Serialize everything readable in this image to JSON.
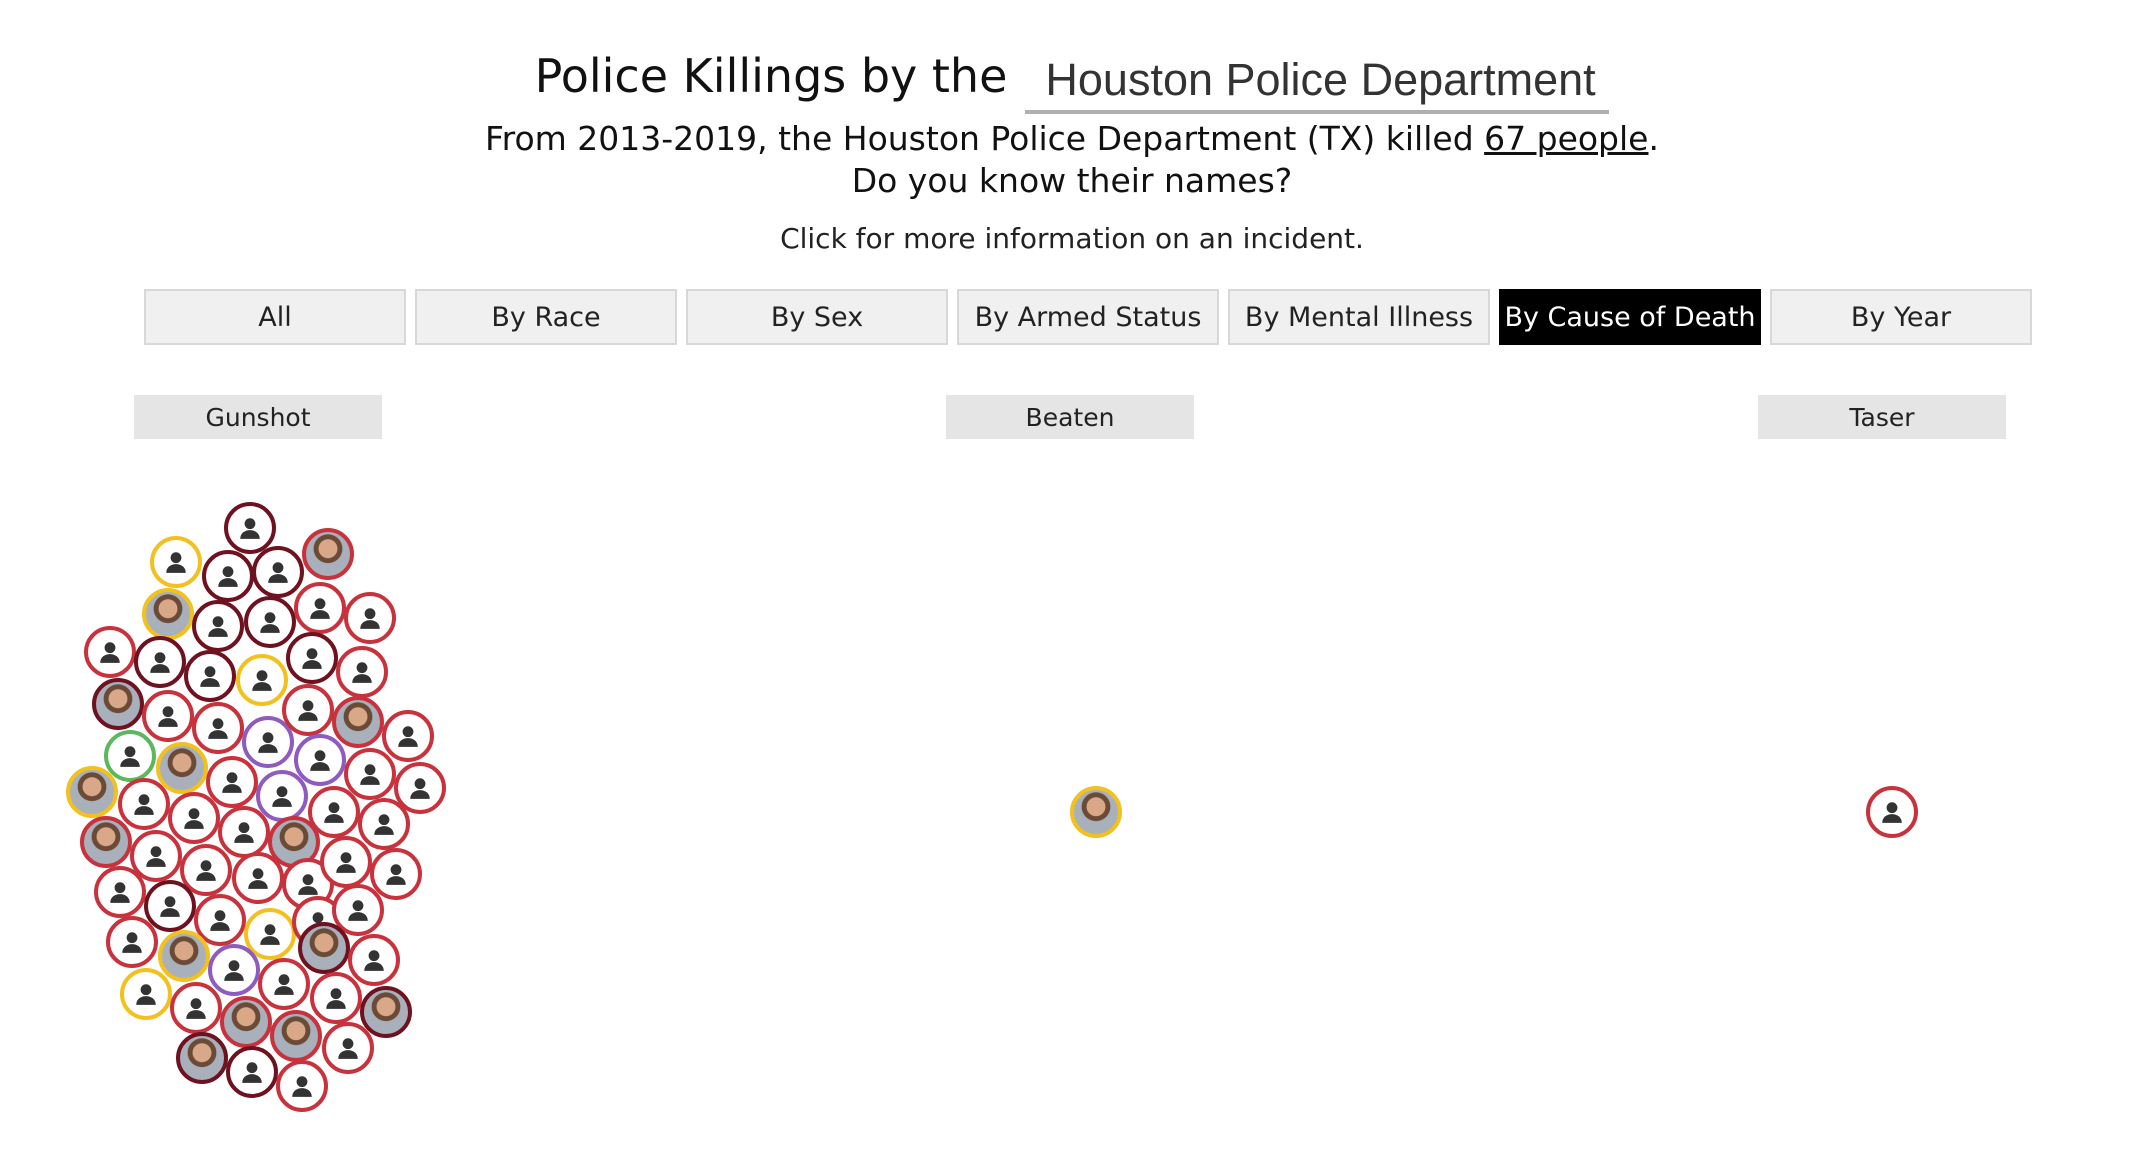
{
  "header": {
    "title_prefix": "Police Killings by the",
    "department": "Houston Police Department (TX"
  },
  "summary": {
    "line1_prefix": "From 2013-2019, the Houston Police Department (TX) killed ",
    "line1_link": "67 people",
    "line1_suffix": ".",
    "line2": "Do you know their names?"
  },
  "hint": "Click for more information on an incident.",
  "tabs": [
    {
      "label": "All",
      "active": false
    },
    {
      "label": "By Race",
      "active": false
    },
    {
      "label": "By Sex",
      "active": false
    },
    {
      "label": "By Armed Status",
      "active": false
    },
    {
      "label": "By Mental Illness",
      "active": false
    },
    {
      "label": "By Cause of Death",
      "active": true
    },
    {
      "label": "By Year",
      "active": false
    }
  ],
  "groups": [
    {
      "label": "Gunshot",
      "count": 65
    },
    {
      "label": "Beaten",
      "count": 1
    },
    {
      "label": "Taser",
      "count": 1
    }
  ],
  "colors": {
    "red": "#c8323c",
    "dark_red": "#6e1220",
    "yellow": "#f2c01f",
    "green": "#5cb85c",
    "purple": "#8e5bbf",
    "active_tab": "#000000"
  },
  "icons": {
    "placeholder": "person-icon"
  }
}
